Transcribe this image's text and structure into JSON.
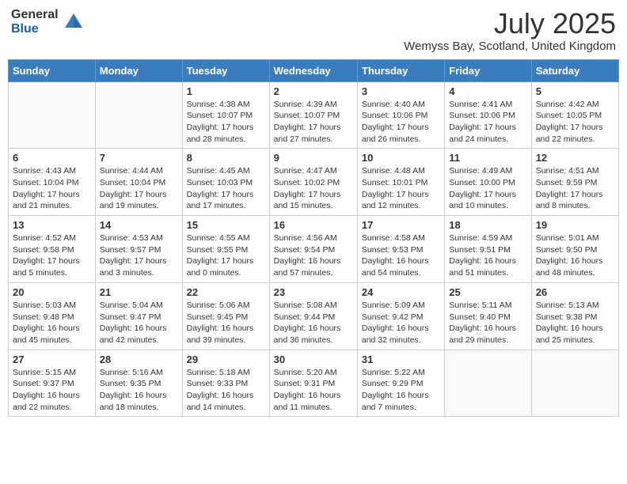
{
  "header": {
    "logo_general": "General",
    "logo_blue": "Blue",
    "month_title": "July 2025",
    "location": "Wemyss Bay, Scotland, United Kingdom"
  },
  "weekdays": [
    "Sunday",
    "Monday",
    "Tuesday",
    "Wednesday",
    "Thursday",
    "Friday",
    "Saturday"
  ],
  "weeks": [
    [
      {
        "day": "",
        "empty": true
      },
      {
        "day": "",
        "empty": true
      },
      {
        "day": "1",
        "sunrise": "4:38 AM",
        "sunset": "10:07 PM",
        "daylight": "17 hours and 28 minutes."
      },
      {
        "day": "2",
        "sunrise": "4:39 AM",
        "sunset": "10:07 PM",
        "daylight": "17 hours and 27 minutes."
      },
      {
        "day": "3",
        "sunrise": "4:40 AM",
        "sunset": "10:06 PM",
        "daylight": "17 hours and 26 minutes."
      },
      {
        "day": "4",
        "sunrise": "4:41 AM",
        "sunset": "10:06 PM",
        "daylight": "17 hours and 24 minutes."
      },
      {
        "day": "5",
        "sunrise": "4:42 AM",
        "sunset": "10:05 PM",
        "daylight": "17 hours and 22 minutes."
      }
    ],
    [
      {
        "day": "6",
        "sunrise": "4:43 AM",
        "sunset": "10:04 PM",
        "daylight": "17 hours and 21 minutes."
      },
      {
        "day": "7",
        "sunrise": "4:44 AM",
        "sunset": "10:04 PM",
        "daylight": "17 hours and 19 minutes."
      },
      {
        "day": "8",
        "sunrise": "4:45 AM",
        "sunset": "10:03 PM",
        "daylight": "17 hours and 17 minutes."
      },
      {
        "day": "9",
        "sunrise": "4:47 AM",
        "sunset": "10:02 PM",
        "daylight": "17 hours and 15 minutes."
      },
      {
        "day": "10",
        "sunrise": "4:48 AM",
        "sunset": "10:01 PM",
        "daylight": "17 hours and 12 minutes."
      },
      {
        "day": "11",
        "sunrise": "4:49 AM",
        "sunset": "10:00 PM",
        "daylight": "17 hours and 10 minutes."
      },
      {
        "day": "12",
        "sunrise": "4:51 AM",
        "sunset": "9:59 PM",
        "daylight": "17 hours and 8 minutes."
      }
    ],
    [
      {
        "day": "13",
        "sunrise": "4:52 AM",
        "sunset": "9:58 PM",
        "daylight": "17 hours and 5 minutes."
      },
      {
        "day": "14",
        "sunrise": "4:53 AM",
        "sunset": "9:57 PM",
        "daylight": "17 hours and 3 minutes."
      },
      {
        "day": "15",
        "sunrise": "4:55 AM",
        "sunset": "9:55 PM",
        "daylight": "17 hours and 0 minutes."
      },
      {
        "day": "16",
        "sunrise": "4:56 AM",
        "sunset": "9:54 PM",
        "daylight": "16 hours and 57 minutes."
      },
      {
        "day": "17",
        "sunrise": "4:58 AM",
        "sunset": "9:53 PM",
        "daylight": "16 hours and 54 minutes."
      },
      {
        "day": "18",
        "sunrise": "4:59 AM",
        "sunset": "9:51 PM",
        "daylight": "16 hours and 51 minutes."
      },
      {
        "day": "19",
        "sunrise": "5:01 AM",
        "sunset": "9:50 PM",
        "daylight": "16 hours and 48 minutes."
      }
    ],
    [
      {
        "day": "20",
        "sunrise": "5:03 AM",
        "sunset": "9:48 PM",
        "daylight": "16 hours and 45 minutes."
      },
      {
        "day": "21",
        "sunrise": "5:04 AM",
        "sunset": "9:47 PM",
        "daylight": "16 hours and 42 minutes."
      },
      {
        "day": "22",
        "sunrise": "5:06 AM",
        "sunset": "9:45 PM",
        "daylight": "16 hours and 39 minutes."
      },
      {
        "day": "23",
        "sunrise": "5:08 AM",
        "sunset": "9:44 PM",
        "daylight": "16 hours and 36 minutes."
      },
      {
        "day": "24",
        "sunrise": "5:09 AM",
        "sunset": "9:42 PM",
        "daylight": "16 hours and 32 minutes."
      },
      {
        "day": "25",
        "sunrise": "5:11 AM",
        "sunset": "9:40 PM",
        "daylight": "16 hours and 29 minutes."
      },
      {
        "day": "26",
        "sunrise": "5:13 AM",
        "sunset": "9:38 PM",
        "daylight": "16 hours and 25 minutes."
      }
    ],
    [
      {
        "day": "27",
        "sunrise": "5:15 AM",
        "sunset": "9:37 PM",
        "daylight": "16 hours and 22 minutes."
      },
      {
        "day": "28",
        "sunrise": "5:16 AM",
        "sunset": "9:35 PM",
        "daylight": "16 hours and 18 minutes."
      },
      {
        "day": "29",
        "sunrise": "5:18 AM",
        "sunset": "9:33 PM",
        "daylight": "16 hours and 14 minutes."
      },
      {
        "day": "30",
        "sunrise": "5:20 AM",
        "sunset": "9:31 PM",
        "daylight": "16 hours and 11 minutes."
      },
      {
        "day": "31",
        "sunrise": "5:22 AM",
        "sunset": "9:29 PM",
        "daylight": "16 hours and 7 minutes."
      },
      {
        "day": "",
        "empty": true
      },
      {
        "day": "",
        "empty": true
      }
    ]
  ]
}
